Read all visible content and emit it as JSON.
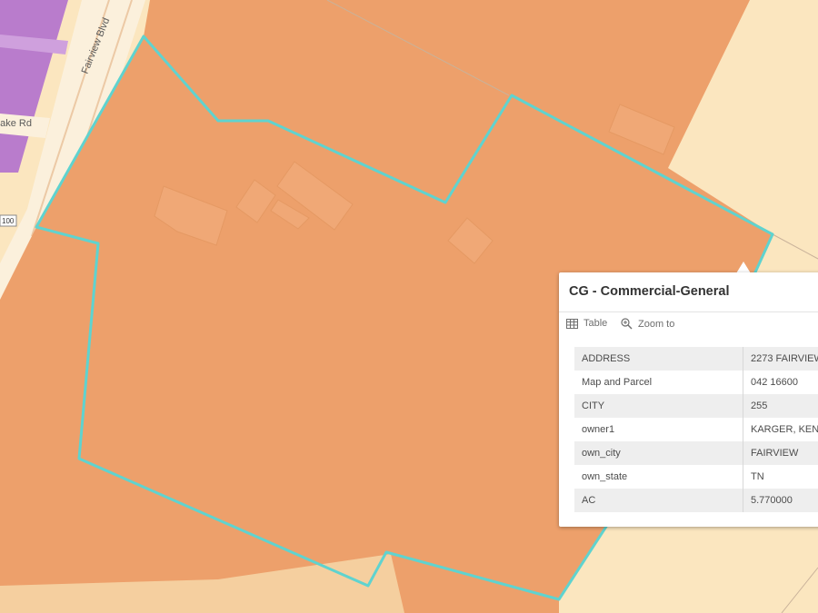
{
  "map": {
    "road_labels": [
      "Fairview Blvd",
      "Lake Rd"
    ],
    "route_shield": "100",
    "colors": {
      "commercial_general": "#eda06b",
      "building": "#f0a876",
      "parcel_outline": "#5fd3cf",
      "residential_light": "#fbe6bf",
      "purple_zone": "#b97ccc",
      "road": "#fbf0dc"
    }
  },
  "popup": {
    "title": "CG - Commercial-General",
    "actions": [
      {
        "label": "Table",
        "icon": "table-icon"
      },
      {
        "label": "Zoom to",
        "icon": "zoom-in-icon"
      }
    ],
    "attributes": [
      {
        "key": "ADDRESS",
        "value": "2273 FAIRVIEW"
      },
      {
        "key": "Map and Parcel",
        "value": "042 16600"
      },
      {
        "key": "CITY",
        "value": "255"
      },
      {
        "key": "owner1",
        "value": "KARGER, KEN"
      },
      {
        "key": "own_city",
        "value": "FAIRVIEW"
      },
      {
        "key": "own_state",
        "value": "TN"
      },
      {
        "key": "AC",
        "value": "5.770000"
      }
    ]
  }
}
